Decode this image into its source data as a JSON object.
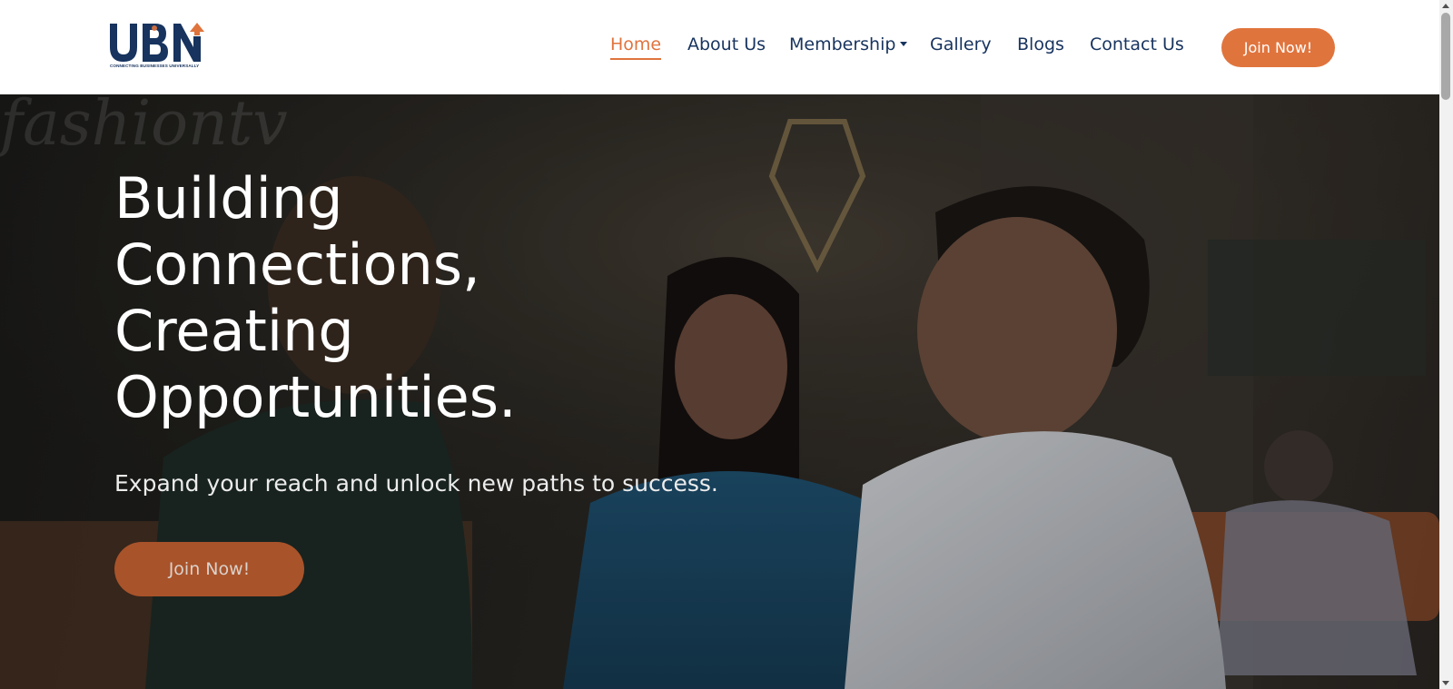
{
  "brand": {
    "logo_text": "UBN",
    "tagline": "CONNECTING BUSINESSES UNIVERSALLY",
    "colors": {
      "navy": "#17335e",
      "orange": "#e0743d"
    }
  },
  "nav": {
    "items": [
      {
        "label": "Home",
        "active": true
      },
      {
        "label": "About Us",
        "active": false
      },
      {
        "label": "Membership",
        "active": false,
        "has_dropdown": true
      },
      {
        "label": "Gallery",
        "active": false
      },
      {
        "label": "Blogs",
        "active": false
      },
      {
        "label": "Contact Us",
        "active": false
      }
    ],
    "cta_label": "Join Now!"
  },
  "hero": {
    "title_lines": [
      "Building",
      "Connections,",
      "Creating",
      "Opportunities."
    ],
    "subtitle": "Expand your reach and unlock new paths to success.",
    "cta_label": "Join Now!",
    "background_text": "fashiontv",
    "accent_color": "#a9532a"
  },
  "icons": {
    "logo_arrow": "up-arrow-icon",
    "dropdown": "caret-down-icon"
  }
}
